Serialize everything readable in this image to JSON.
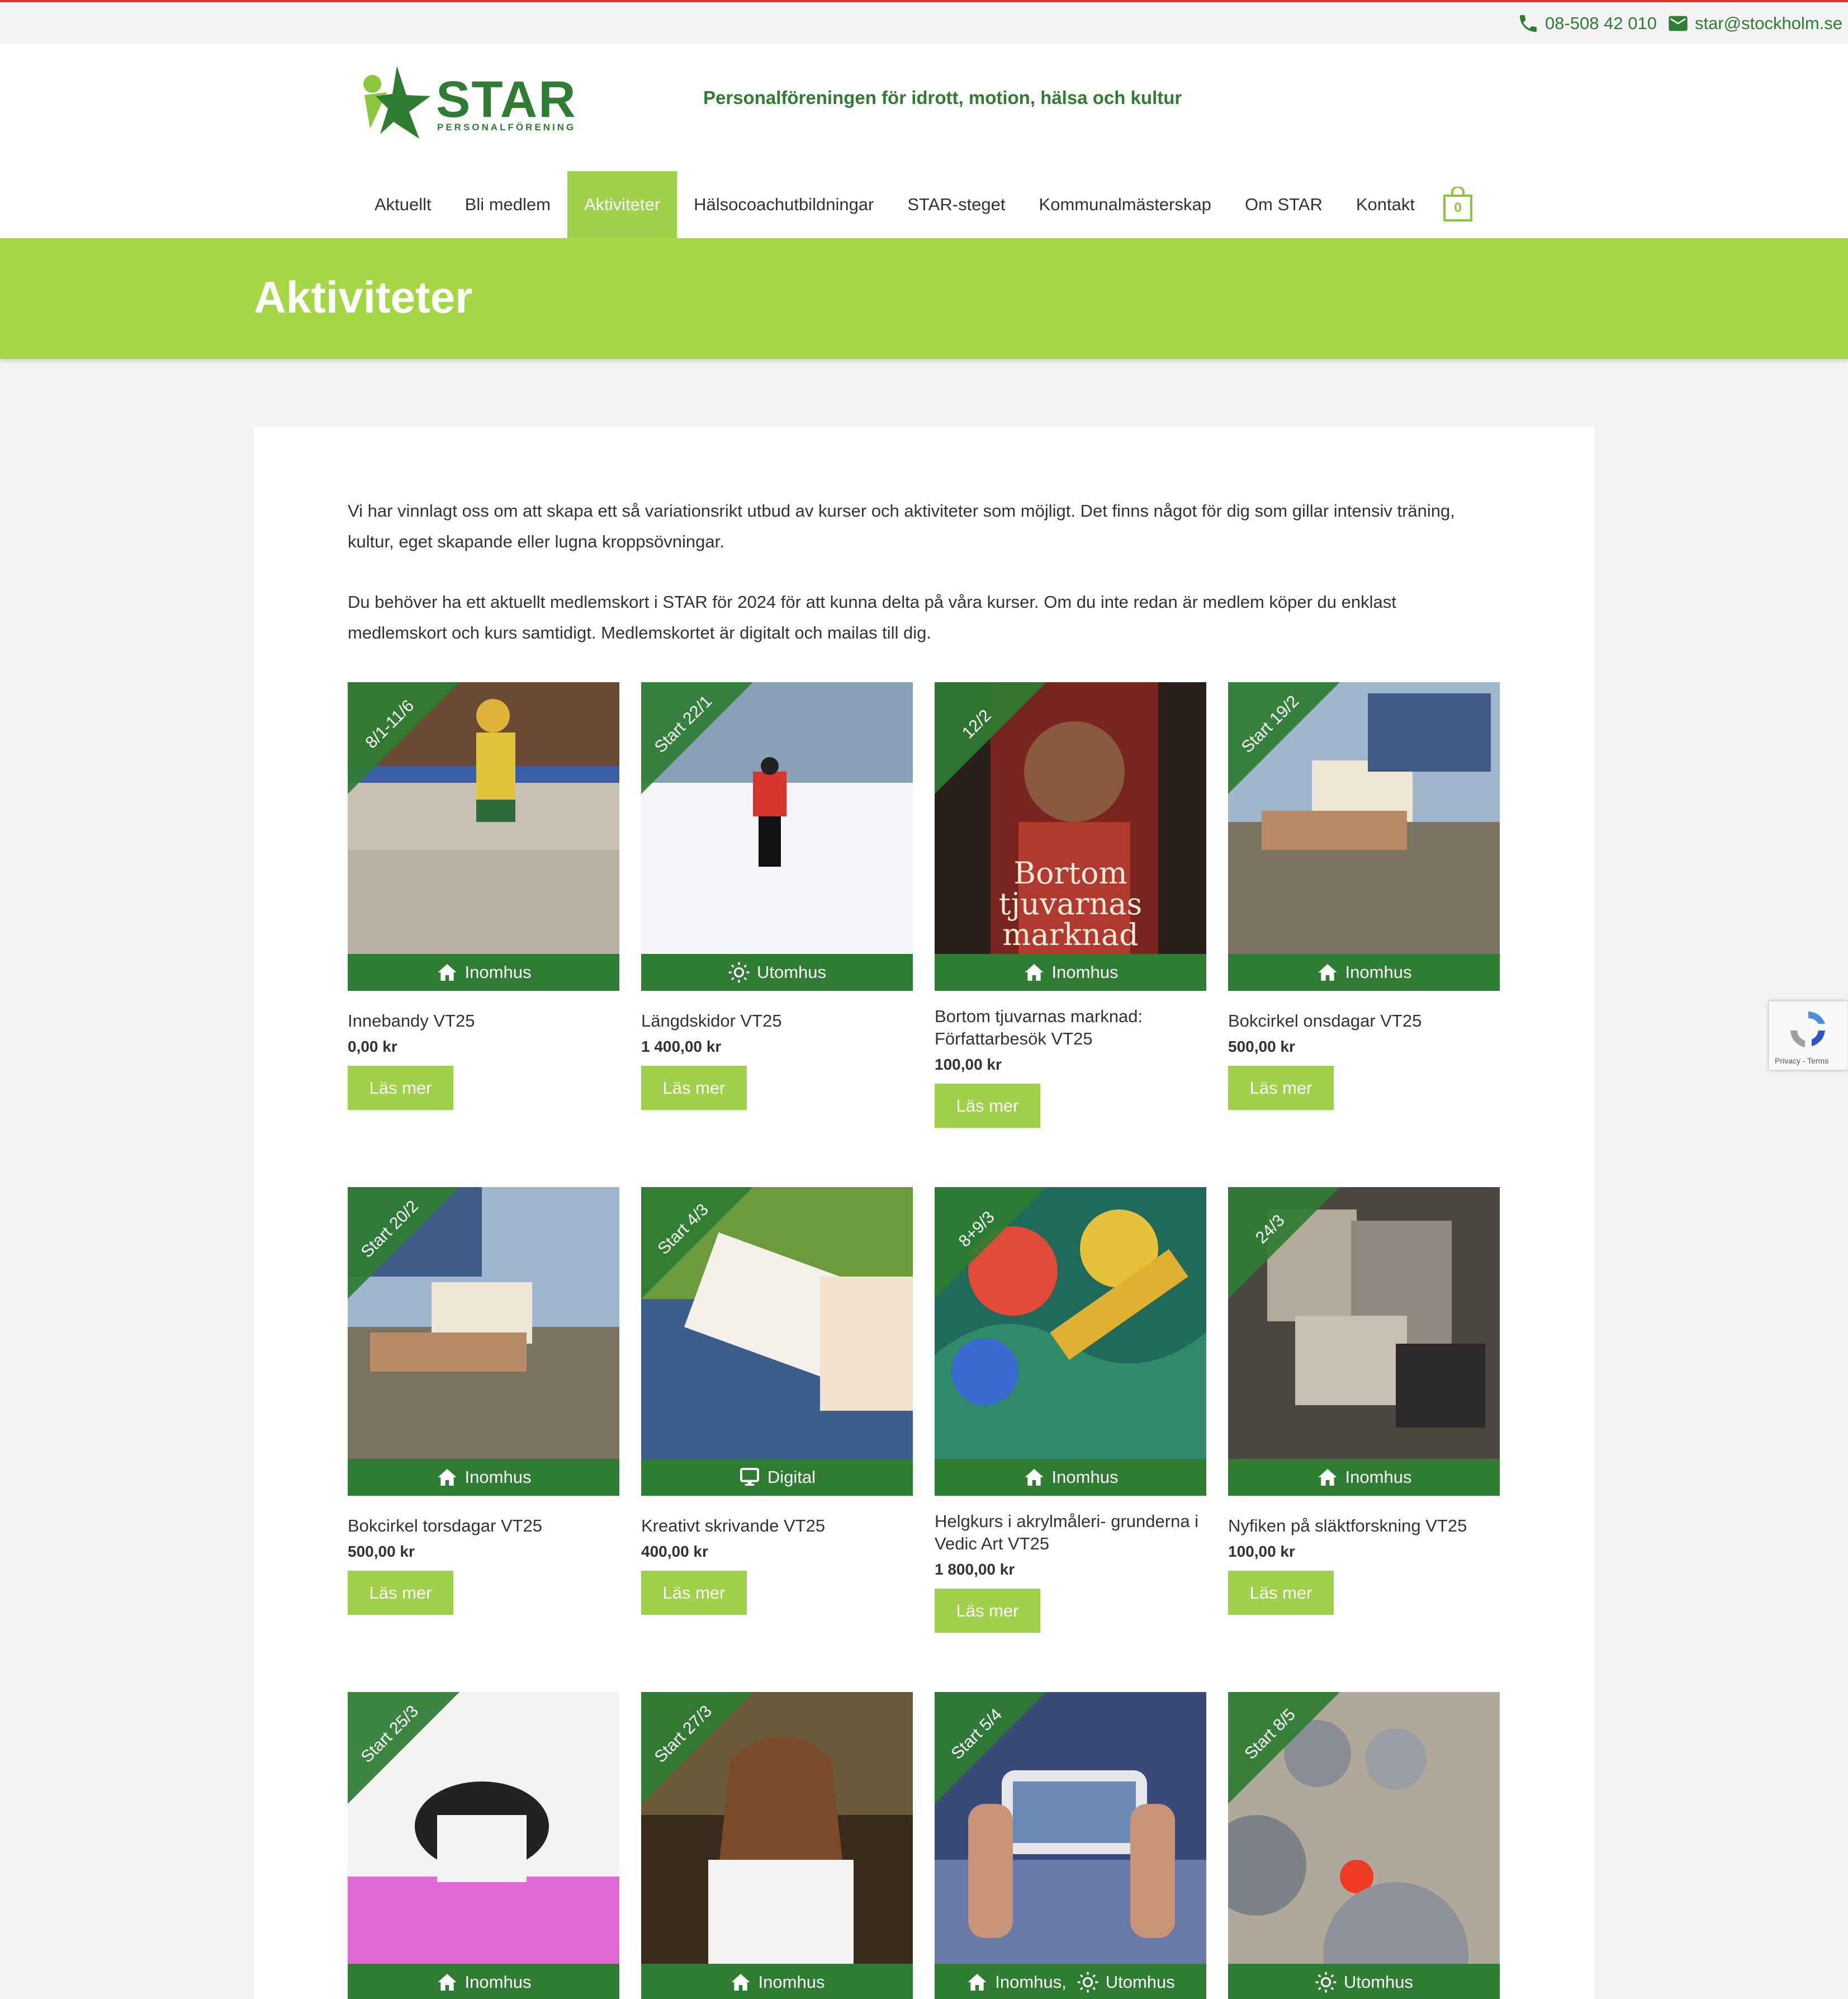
{
  "topbar": {
    "phone": "08-508 42 010",
    "email": "star@stockholm.se",
    "phone_icon": "phone-icon",
    "email_icon": "mail-icon"
  },
  "header": {
    "logo_word": "STAR",
    "logo_sub": "PERSONALFÖRENING",
    "tagline": "Personalföreningen för idrott, motion, hälsa och kultur",
    "cart_count": "0"
  },
  "nav": [
    {
      "label": "Aktuellt",
      "active": false
    },
    {
      "label": "Bli medlem",
      "active": false
    },
    {
      "label": "Aktiviteter",
      "active": true
    },
    {
      "label": "Hälsocoachutbildningar",
      "active": false
    },
    {
      "label": "STAR-steget",
      "active": false
    },
    {
      "label": "Kommunalmästerskap",
      "active": false
    },
    {
      "label": "Om STAR",
      "active": false
    },
    {
      "label": "Kontakt",
      "active": false
    }
  ],
  "page_title": "Aktiviteter",
  "intro": {
    "p1": "Vi har vinnlagt oss om att skapa ett så variationsrikt utbud av kurser och aktiviteter som möjligt. Det finns något för dig som gillar intensiv träning, kultur, eget skapande eller lugna kroppsövningar.",
    "p2": "Du behöver ha ett aktuellt medlemskort i STAR för 2024 för att kunna delta på våra kurser. Om du inte redan är medlem köper du enklast medlemskort och kurs samtidigt. Medlemskortet är digitalt och mailas till dig."
  },
  "button_label": "Läs mer",
  "products": [
    {
      "title": "Innebandy VT25",
      "price": "0,00 kr",
      "ribbon": "8/1-11/6",
      "badges": [
        {
          "icon": "home-icon",
          "label": "Inomhus"
        }
      ]
    },
    {
      "title": "Längdskidor VT25",
      "price": "1 400,00 kr",
      "ribbon": "Start 22/1",
      "badges": [
        {
          "icon": "sun-icon",
          "label": "Utomhus"
        }
      ]
    },
    {
      "title": "Bortom tjuvarnas marknad: Författarbesök VT25",
      "price": "100,00 kr",
      "ribbon": "12/2",
      "badges": [
        {
          "icon": "home-icon",
          "label": "Inomhus"
        }
      ],
      "cover_text": "Bortom tjuvarnas marknad"
    },
    {
      "title": "Bokcirkel onsdagar VT25",
      "price": "500,00 kr",
      "ribbon": "Start 19/2",
      "badges": [
        {
          "icon": "home-icon",
          "label": "Inomhus"
        }
      ]
    },
    {
      "title": "Bokcirkel torsdagar VT25",
      "price": "500,00 kr",
      "ribbon": "Start 20/2",
      "badges": [
        {
          "icon": "home-icon",
          "label": "Inomhus"
        }
      ]
    },
    {
      "title": "Kreativt skrivande VT25",
      "price": "400,00 kr",
      "ribbon": "Start 4/3",
      "badges": [
        {
          "icon": "monitor-icon",
          "label": "Digital"
        }
      ]
    },
    {
      "title": "Helgkurs i akrylmåleri- grunderna i Vedic Art VT25",
      "price": "1 800,00 kr",
      "ribbon": "8+9/3",
      "badges": [
        {
          "icon": "home-icon",
          "label": "Inomhus"
        }
      ]
    },
    {
      "title": "Nyfiken på släktforskning VT25",
      "price": "100,00 kr",
      "ribbon": "24/3",
      "badges": [
        {
          "icon": "home-icon",
          "label": "Inomhus"
        }
      ]
    },
    {
      "title": "",
      "price": "",
      "ribbon": "Start 25/3",
      "badges": [
        {
          "icon": "home-icon",
          "label": "Inomhus"
        }
      ]
    },
    {
      "title": "",
      "price": "",
      "ribbon": "Start 27/3",
      "badges": [
        {
          "icon": "home-icon",
          "label": "Inomhus"
        }
      ]
    },
    {
      "title": "",
      "price": "",
      "ribbon": "Start 5/4",
      "badges": [
        {
          "icon": "home-icon",
          "label": "Inomhus,"
        },
        {
          "icon": "sun-icon",
          "label": "Utomhus"
        }
      ]
    },
    {
      "title": "",
      "price": "",
      "ribbon": "Start 8/5",
      "badges": [
        {
          "icon": "sun-icon",
          "label": "Utomhus"
        }
      ]
    }
  ],
  "recaptcha": {
    "terms": "Privacy - Terms"
  },
  "colors": {
    "brand_green": "#2e7d32",
    "lime": "#a4d645",
    "button": "#9fd14a",
    "accent_red": "#d23a2a"
  }
}
